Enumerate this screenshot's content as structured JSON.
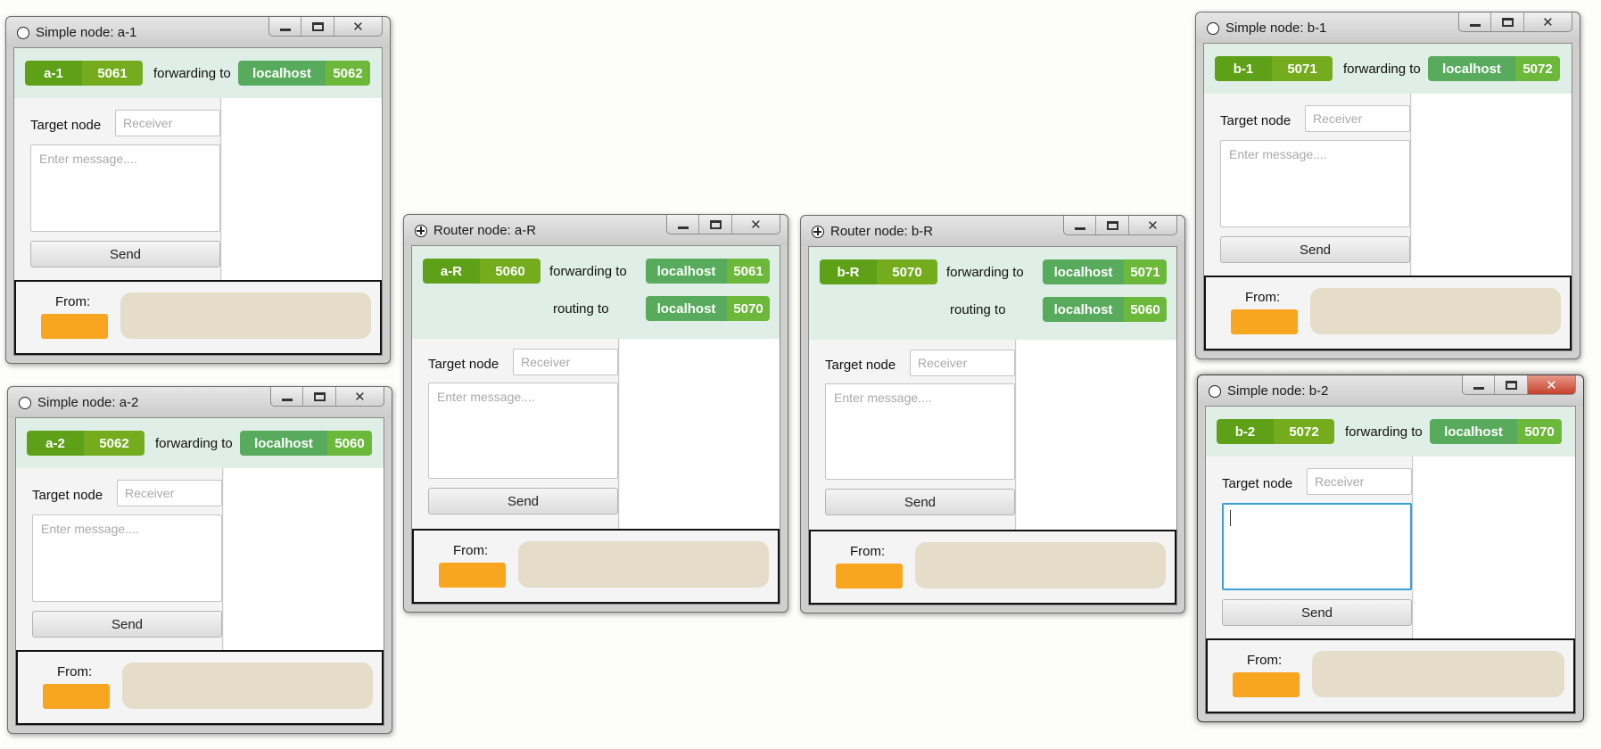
{
  "windows": {
    "a1": {
      "title": "Simple node: a-1",
      "name": "a-1",
      "port": "5061",
      "forward_label": "forwarding to",
      "forward_host": "localhost",
      "forward_port": "5062",
      "target_label": "Target node",
      "receiver_placeholder": "Receiver",
      "message_placeholder": "Enter message....",
      "send_label": "Send",
      "from_label": "From:"
    },
    "a2": {
      "title": "Simple node: a-2",
      "name": "a-2",
      "port": "5062",
      "forward_label": "forwarding to",
      "forward_host": "localhost",
      "forward_port": "5060",
      "target_label": "Target node",
      "receiver_placeholder": "Receiver",
      "message_placeholder": "Enter message....",
      "send_label": "Send",
      "from_label": "From:"
    },
    "aR": {
      "title": "Router node: a-R",
      "name": "a-R",
      "port": "5060",
      "forward_label": "forwarding to",
      "forward_host": "localhost",
      "forward_port": "5061",
      "routing_label": "routing to",
      "routing_host": "localhost",
      "routing_port": "5070",
      "target_label": "Target node",
      "receiver_placeholder": "Receiver",
      "message_placeholder": "Enter message....",
      "send_label": "Send",
      "from_label": "From:"
    },
    "bR": {
      "title": "Router node: b-R",
      "name": "b-R",
      "port": "5070",
      "forward_label": "forwarding to",
      "forward_host": "localhost",
      "forward_port": "5071",
      "routing_label": "routing to",
      "routing_host": "localhost",
      "routing_port": "5060",
      "target_label": "Target node",
      "receiver_placeholder": "Receiver",
      "message_placeholder": "Enter message....",
      "send_label": "Send",
      "from_label": "From:"
    },
    "b1": {
      "title": "Simple node: b-1",
      "name": "b-1",
      "port": "5071",
      "forward_label": "forwarding to",
      "forward_host": "localhost",
      "forward_port": "5072",
      "target_label": "Target node",
      "receiver_placeholder": "Receiver",
      "message_placeholder": "Enter message....",
      "send_label": "Send",
      "from_label": "From:"
    },
    "b2": {
      "title": "Simple node: b-2",
      "name": "b-2",
      "port": "5072",
      "forward_label": "forwarding to",
      "forward_host": "localhost",
      "forward_port": "5070",
      "target_label": "Target node",
      "receiver_placeholder": "Receiver",
      "message_placeholder": "",
      "send_label": "Send",
      "from_label": "From:"
    }
  },
  "colors": {
    "self_name": "#5ea118",
    "self_port": "#74ac1e",
    "target_name": "#58ab5d",
    "target_port": "#6cb83a",
    "from_badge": "#f8a51f",
    "message_bubble": "#e5ddca",
    "header_bg": "#dfeee6",
    "focus_border": "#3ba0d8"
  }
}
